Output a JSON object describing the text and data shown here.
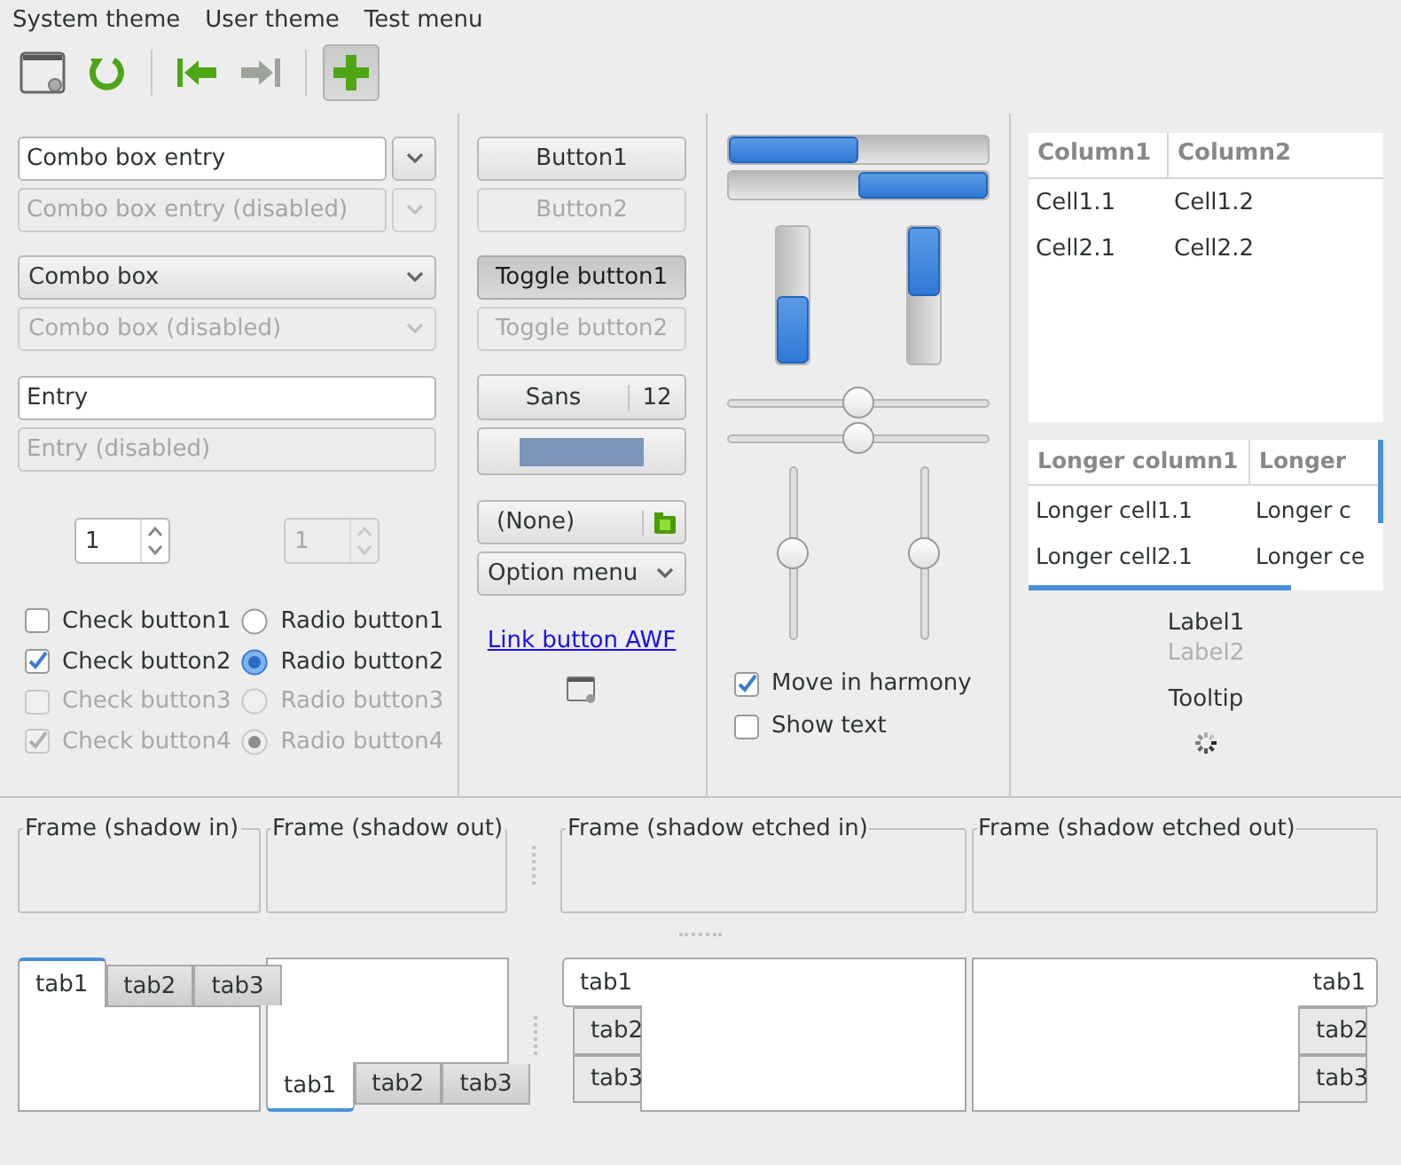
{
  "menu": [
    {
      "label": "System theme"
    },
    {
      "label": "User theme"
    },
    {
      "label": "Test menu"
    }
  ],
  "toolbar": [
    {
      "kind": "window",
      "pressed": false,
      "disabled": false
    },
    {
      "kind": "refresh",
      "pressed": false,
      "disabled": false
    },
    {
      "kind": "separator"
    },
    {
      "kind": "back",
      "pressed": false,
      "disabled": false
    },
    {
      "kind": "forward",
      "pressed": false,
      "disabled": true
    },
    {
      "kind": "separator"
    },
    {
      "kind": "add",
      "pressed": true,
      "disabled": false
    }
  ],
  "inputs": {
    "combo_entries": [
      {
        "value": "Combo box entry",
        "disabled": false
      },
      {
        "value": "Combo box entry (disabled)",
        "disabled": true
      }
    ],
    "combos": [
      {
        "value": "Combo box",
        "disabled": false
      },
      {
        "value": "Combo box (disabled)",
        "disabled": true
      }
    ],
    "entries": [
      {
        "value": "Entry",
        "disabled": false
      },
      {
        "value": "Entry (disabled)",
        "disabled": true
      }
    ],
    "spin_buttons": [
      {
        "value": "1",
        "disabled": false
      },
      {
        "value": "1",
        "disabled": true
      }
    ],
    "check_buttons": [
      {
        "label": "Check button1",
        "checked": false,
        "disabled": false
      },
      {
        "label": "Check button2",
        "checked": true,
        "disabled": false
      },
      {
        "label": "Check button3",
        "checked": false,
        "disabled": true
      },
      {
        "label": "Check button4",
        "checked": true,
        "disabled": true
      }
    ],
    "radio_buttons": [
      {
        "label": "Radio button1",
        "selected": false,
        "disabled": false
      },
      {
        "label": "Radio button2",
        "selected": true,
        "disabled": false
      },
      {
        "label": "Radio button3",
        "selected": false,
        "disabled": true
      },
      {
        "label": "Radio button4",
        "selected": true,
        "disabled": true
      }
    ]
  },
  "buttons": {
    "push": [
      {
        "label": "Button1",
        "disabled": false
      },
      {
        "label": "Button2",
        "disabled": true
      }
    ],
    "toggle": [
      {
        "label": "Toggle button1",
        "on": true,
        "disabled": false
      },
      {
        "label": "Toggle button2",
        "on": false,
        "disabled": true
      }
    ],
    "font": {
      "family": "Sans",
      "size": "12"
    },
    "color": {
      "color": "#7b96b8"
    },
    "file": {
      "label": "(None)"
    },
    "option_menu": {
      "label": "Option menu"
    },
    "link": {
      "label": "Link button AWF"
    }
  },
  "ranges": {
    "progress_bars": [
      {
        "kind": "horizontal",
        "inverted": false,
        "level": 0.5
      },
      {
        "kind": "horizontal",
        "inverted": true,
        "level": 0.5
      },
      {
        "kind": "vertical",
        "inverted": true,
        "level": 0.5
      },
      {
        "kind": "vertical",
        "inverted": false,
        "level": 0.5
      }
    ],
    "horizontal_scales": [
      {
        "level": 0.5
      },
      {
        "level": 0.5
      }
    ],
    "vertical_scales": [
      {
        "level": 0.5
      },
      {
        "level": 0.5
      }
    ],
    "check_buttons": [
      {
        "label": "Move in harmony",
        "checked": true
      },
      {
        "label": "Show text",
        "checked": false
      }
    ]
  },
  "lists": {
    "tree_views": [
      {
        "columns": [
          "Column1",
          "Column2"
        ],
        "rows": [
          [
            "Cell1.1",
            "Cell1.2"
          ],
          [
            "Cell2.1",
            "Cell2.2"
          ]
        ]
      },
      {
        "columns": [
          "Longer column1",
          "Longer"
        ],
        "rows": [
          [
            "Longer cell1.1",
            "Longer c"
          ],
          [
            "Longer cell2.1",
            "Longer ce"
          ]
        ]
      }
    ],
    "labels": [
      {
        "text": "Label1",
        "disabled": false
      },
      {
        "text": "Label2",
        "disabled": true
      }
    ],
    "tooltip_label": "Tooltip"
  },
  "frames": [
    {
      "label": "Frame (shadow in)"
    },
    {
      "label": "Frame (shadow out)"
    },
    {
      "label": "Frame (shadow etched in)"
    },
    {
      "label": "Frame (shadow etched out)"
    }
  ],
  "notebooks": [
    {
      "kind": "top",
      "tabs": [
        {
          "label": "tab1",
          "selected": true
        },
        {
          "label": "tab2",
          "selected": false
        },
        {
          "label": "tab3",
          "selected": false
        }
      ]
    },
    {
      "kind": "bottom",
      "tabs": [
        {
          "label": "tab1",
          "selected": true
        },
        {
          "label": "tab2",
          "selected": false
        },
        {
          "label": "tab3",
          "selected": false
        }
      ]
    },
    {
      "kind": "left",
      "tabs": [
        {
          "label": "tab1",
          "selected": true
        },
        {
          "label": "tab2",
          "selected": false
        },
        {
          "label": "tab3",
          "selected": false
        }
      ]
    },
    {
      "kind": "right",
      "tabs": [
        {
          "label": "tab1",
          "selected": true
        },
        {
          "label": "tab2",
          "selected": false
        },
        {
          "label": "tab3",
          "selected": false
        }
      ]
    }
  ]
}
